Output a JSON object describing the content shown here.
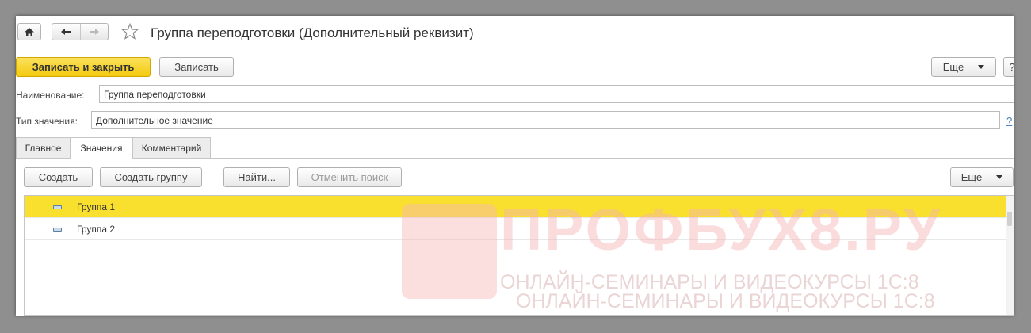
{
  "window": {
    "title": "Группа переподготовки (Дополнительный реквизит)"
  },
  "toolbar": {
    "save_close_label": "Записать и закрыть",
    "save_label": "Записать",
    "more_label": "Еще",
    "help_label": "?"
  },
  "form": {
    "name_label": "Наименование:",
    "name_value": "Группа переподготовки",
    "type_label": "Тип значения:",
    "type_value": "Дополнительное значение",
    "type_help": "?"
  },
  "tabs": [
    {
      "label": "Главное",
      "active": false
    },
    {
      "label": "Значения",
      "active": true
    },
    {
      "label": "Комментарий",
      "active": false
    }
  ],
  "list_toolbar": {
    "create_label": "Создать",
    "create_group_label": "Создать группу",
    "find_label": "Найти...",
    "cancel_search_label": "Отменить поиск",
    "more_label": "Еще"
  },
  "list": {
    "rows": [
      {
        "label": "Группа 1",
        "selected": true
      },
      {
        "label": "Группа 2",
        "selected": false
      }
    ]
  },
  "watermark": {
    "brand": "ПРОФБУХ8.РУ",
    "tagline": "ОНЛАЙН-СЕМИНАРЫ И ВИДЕОКУРСЫ 1С:8"
  },
  "colors": {
    "accent_yellow": "#f4c90f",
    "selected_row": "#f9df2e",
    "link_blue": "#4a7fc1"
  },
  "icons": {
    "home": "home-icon",
    "back": "arrow-left-icon",
    "forward": "arrow-right-icon",
    "favorite": "star-icon",
    "row": "group-item-icon"
  }
}
